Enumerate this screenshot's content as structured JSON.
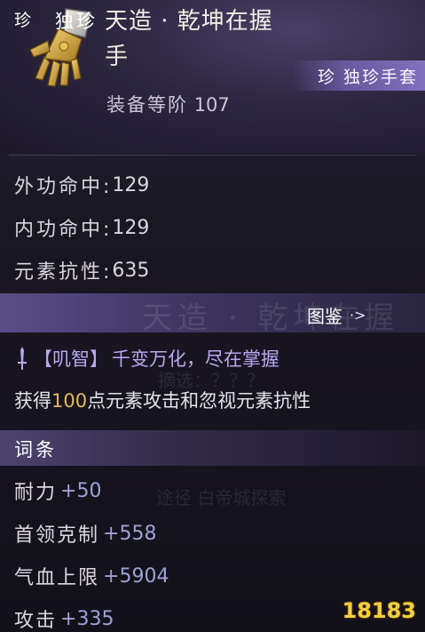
{
  "item": {
    "title_line1": "天造 · 乾坤在握",
    "title_line2": "手",
    "quality_tag": "珍 独珍手套",
    "rank_label": "装备等阶",
    "rank_value": "107"
  },
  "stats": [
    {
      "label": "外功命中:",
      "value": "129"
    },
    {
      "label": "内功命中:",
      "value": "129"
    },
    {
      "label": "元素抗性:",
      "value": "635"
    }
  ],
  "unique": {
    "icon_text": "珍",
    "label": "独珍",
    "bg_text": "天造 · 乾坤在握",
    "tujian_label": "图鉴",
    "tujian_chevron": "·>"
  },
  "skill": {
    "name": "【叽智】",
    "tagline": "千变万化，尽在掌握",
    "desc_before": "获得",
    "desc_num": "100",
    "desc_after": "点元素攻击和忽视元素抗性",
    "ghost1": "摘选：？？？",
    "ghost2": "摘选：？？？",
    "ghost3": "途径  白帝城探索"
  },
  "entries_title": "词条",
  "entries": [
    {
      "label": "耐力",
      "value": "+50"
    },
    {
      "label": "首领克制",
      "value": "+558"
    },
    {
      "label": "气血上限",
      "value": "+5904"
    },
    {
      "label": "攻击",
      "value": "+335"
    }
  ],
  "watermark": "18183"
}
